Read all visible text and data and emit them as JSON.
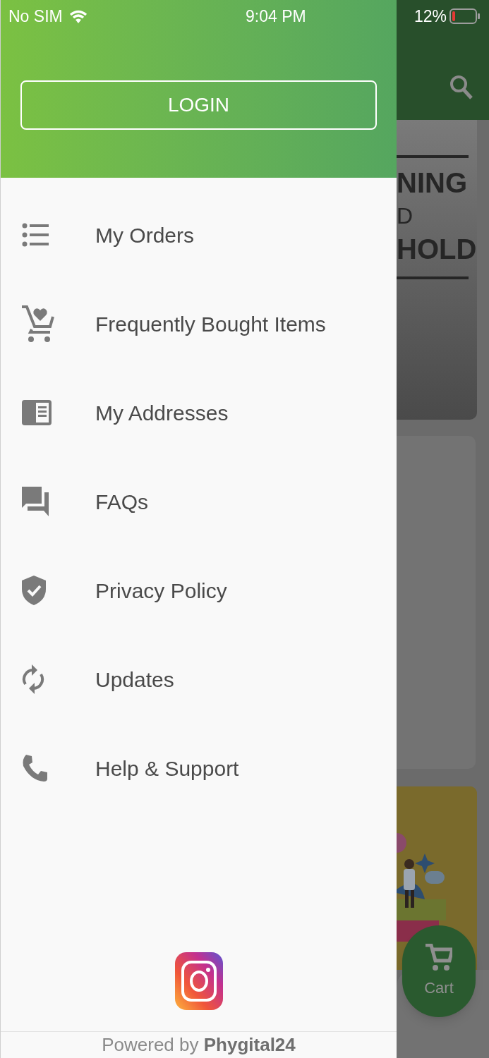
{
  "status_bar": {
    "carrier": "No SIM",
    "time": "9:04 PM",
    "battery": "12%"
  },
  "drawer": {
    "login_button": "LOGIN",
    "menu": [
      {
        "label": "My Orders"
      },
      {
        "label": "Frequently Bought Items"
      },
      {
        "label": "My Addresses"
      },
      {
        "label": "FAQs"
      },
      {
        "label": "Privacy Policy"
      },
      {
        "label": "Updates"
      },
      {
        "label": "Help & Support"
      }
    ],
    "footer": "Powered by **Phygital24**"
  },
  "background": {
    "banner_lines": [
      "NING",
      "D",
      "HOLD"
    ],
    "cart_button": "Cart"
  }
}
